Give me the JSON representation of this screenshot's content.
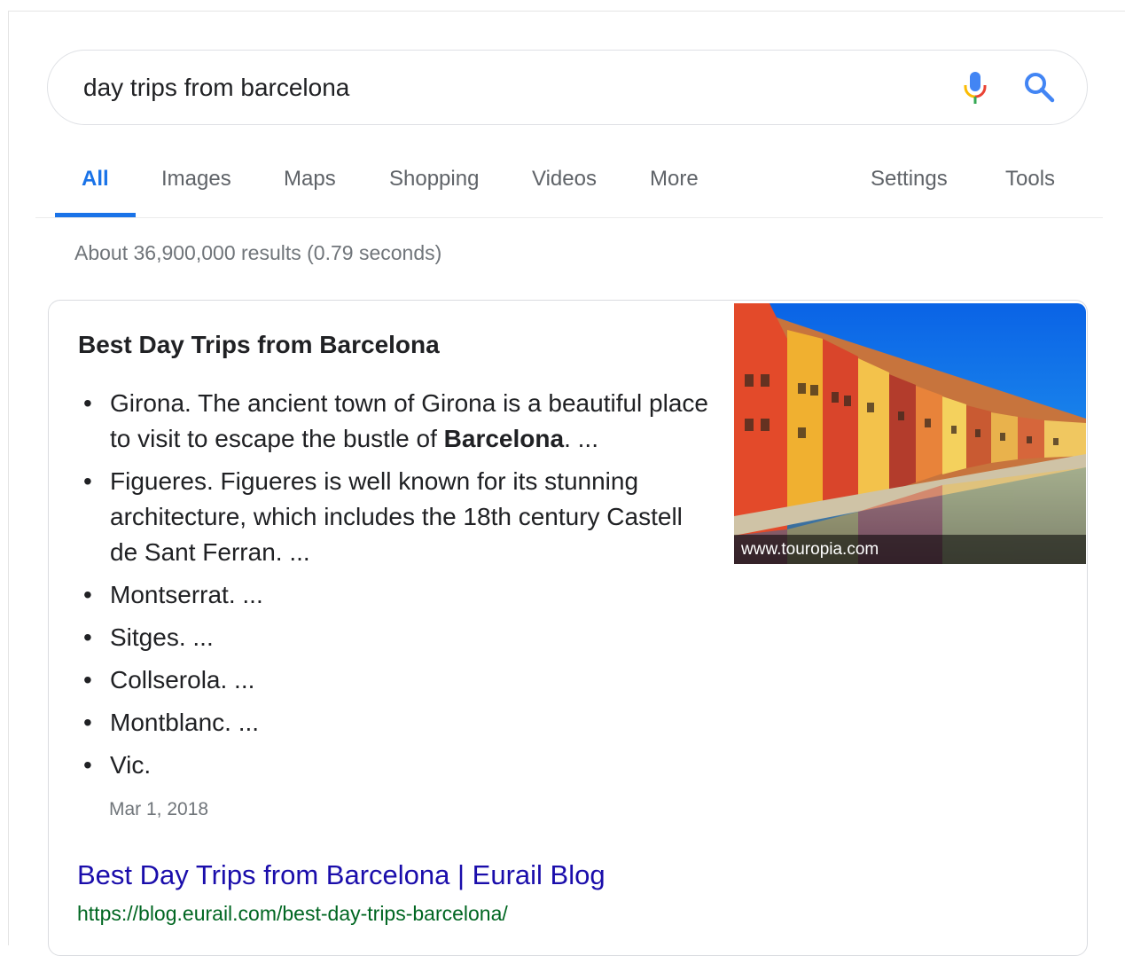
{
  "search": {
    "query": "day trips from barcelona"
  },
  "tabs": [
    {
      "label": "All",
      "active": true
    },
    {
      "label": "Images"
    },
    {
      "label": "Maps"
    },
    {
      "label": "Shopping"
    },
    {
      "label": "Videos"
    },
    {
      "label": "More"
    },
    {
      "label": "Settings"
    },
    {
      "label": "Tools"
    }
  ],
  "stats": "About 36,900,000 results (0.79 seconds)",
  "featured": {
    "title": "Best Day Trips from Barcelona",
    "items": [
      {
        "before": "Girona. The ancient town of Girona is a beautiful place to visit to escape the bustle of ",
        "bold": "Barcelona",
        "after": ". ..."
      },
      {
        "before": "Figueres. Figueres is well known for its stunning architecture, which includes the 18th century Castell de Sant Ferran. ...",
        "bold": "",
        "after": ""
      },
      {
        "before": "Montserrat. ...",
        "bold": "",
        "after": ""
      },
      {
        "before": "Sitges. ...",
        "bold": "",
        "after": ""
      },
      {
        "before": "Collserola. ...",
        "bold": "",
        "after": ""
      },
      {
        "before": "Montblanc. ...",
        "bold": "",
        "after": ""
      },
      {
        "before": "Vic.",
        "bold": "",
        "after": ""
      }
    ],
    "bullet": "•",
    "date": "Mar 1, 2018",
    "image_caption": "www.touropia.com",
    "link_title": "Best Day Trips from Barcelona | Eurail Blog",
    "link_url": "https://blog.eurail.com/best-day-trips-barcelona/"
  },
  "colors": {
    "accent": "#1a73e8",
    "link": "#1a0dab",
    "url": "#006621",
    "muted": "#70757a"
  }
}
